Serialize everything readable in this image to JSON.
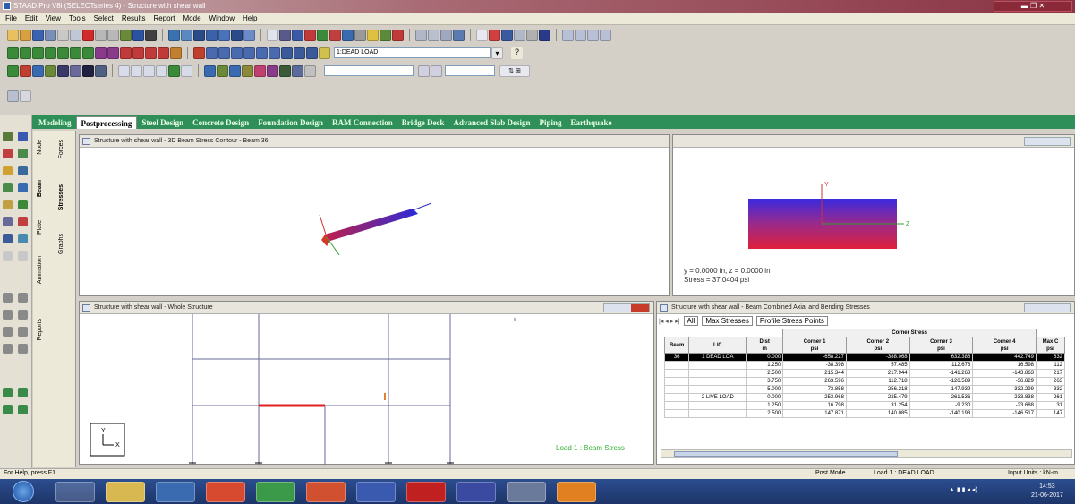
{
  "window": {
    "title": "STAAD.Pro V8i (SELECTseries 4) - Structure with shear wall",
    "controls": "▬ ❐ ✕"
  },
  "menu": [
    "File",
    "Edit",
    "View",
    "Tools",
    "Select",
    "Results",
    "Report",
    "Mode",
    "Window",
    "Help"
  ],
  "toolbar": {
    "load_case": "1:DEAD LOAD",
    "help_icon": "?"
  },
  "page_control": "⇅ ⊞",
  "mode_tabs": [
    {
      "label": "Modeling",
      "active": false
    },
    {
      "label": "Postprocessing",
      "active": true
    },
    {
      "label": "Steel Design",
      "active": false
    },
    {
      "label": "Concrete Design",
      "active": false
    },
    {
      "label": "Foundation Design",
      "active": false
    },
    {
      "label": "RAM Connection",
      "active": false
    },
    {
      "label": "Bridge Deck",
      "active": false
    },
    {
      "label": "Advanced Slab Design",
      "active": false
    },
    {
      "label": "Piping",
      "active": false
    },
    {
      "label": "Earthquake",
      "active": false
    }
  ],
  "side_tabs": {
    "node": "Node",
    "beam": "Beam",
    "forces": "Forces",
    "plate": "Plate",
    "stresses": "Stresses",
    "animation": "Animation",
    "graphs": "Graphs",
    "reports": "Reports"
  },
  "panel_3d": {
    "title": "Structure with shear wall - 3D Beam Stress Contour - Beam 36"
  },
  "section_view": {
    "coord_line": "y = 0.0000 in, z = 0.0000 in",
    "stress_line": "Stress = 37.0404 psi",
    "axis_y": "Y",
    "axis_z": "Z"
  },
  "whole_structure": {
    "title": "Structure with shear wall - Whole Structure",
    "load_label": "Load 1 : Beam Stress",
    "axis_y": "Y",
    "axis_x": "X"
  },
  "stress_table": {
    "title": "Structure with shear wall - Beam Combined Axial and Bending Stresses",
    "tabs": [
      "All",
      "Max Stresses",
      "Profile Stress Points"
    ],
    "group_header": "Corner Stress",
    "columns": [
      "Beam",
      "L/C",
      "Dist\nin",
      "Corner 1\npsi",
      "Corner 2\npsi",
      "Corner 3\npsi",
      "Corner 4\npsi",
      "Max C\npsi"
    ],
    "rows": [
      {
        "beam": "36",
        "lc": "1 DEAD LOA",
        "dist": "0.000",
        "c1": "-658.227",
        "c2": "-388.068",
        "c3": "632.386",
        "c4": "442.749",
        "max": "632",
        "selected": true
      },
      {
        "beam": "",
        "lc": "",
        "dist": "1.250",
        "c1": "-38.398",
        "c2": "57.485",
        "c3": "112.676",
        "c4": "16.598",
        "max": "112",
        "selected": false
      },
      {
        "beam": "",
        "lc": "",
        "dist": "2.500",
        "c1": "215.344",
        "c2": "217.944",
        "c3": "-141.263",
        "c4": "-143.863",
        "max": "217",
        "selected": false
      },
      {
        "beam": "",
        "lc": "",
        "dist": "3.750",
        "c1": "263.596",
        "c2": "112.718",
        "c3": "-126.589",
        "c4": "-36.829",
        "max": "263",
        "selected": false
      },
      {
        "beam": "",
        "lc": "",
        "dist": "5.000",
        "c1": "-73.858",
        "c2": "-256.218",
        "c3": "147.939",
        "c4": "332.299",
        "max": "332",
        "selected": false
      },
      {
        "beam": "",
        "lc": "2 LIVE LOAD",
        "dist": "0.000",
        "c1": "-253.968",
        "c2": "-225.479",
        "c3": "261.536",
        "c4": "233.838",
        "max": "261",
        "selected": false
      },
      {
        "beam": "",
        "lc": "",
        "dist": "1.250",
        "c1": "16.798",
        "c2": "31.254",
        "c3": "-9.230",
        "c4": "-23.688",
        "max": "31",
        "selected": false
      },
      {
        "beam": "",
        "lc": "",
        "dist": "2.500",
        "c1": "147.871",
        "c2": "140.085",
        "c3": "-140.193",
        "c4": "-146.517",
        "max": "147",
        "selected": false
      }
    ]
  },
  "status": {
    "help": "For Help, press F1",
    "mode": "Post Mode",
    "load": "Load 1 : DEAD LOAD",
    "units": "Input Units : kN-m"
  },
  "tray": {
    "time": "14:53",
    "date": "21-06-2017"
  }
}
